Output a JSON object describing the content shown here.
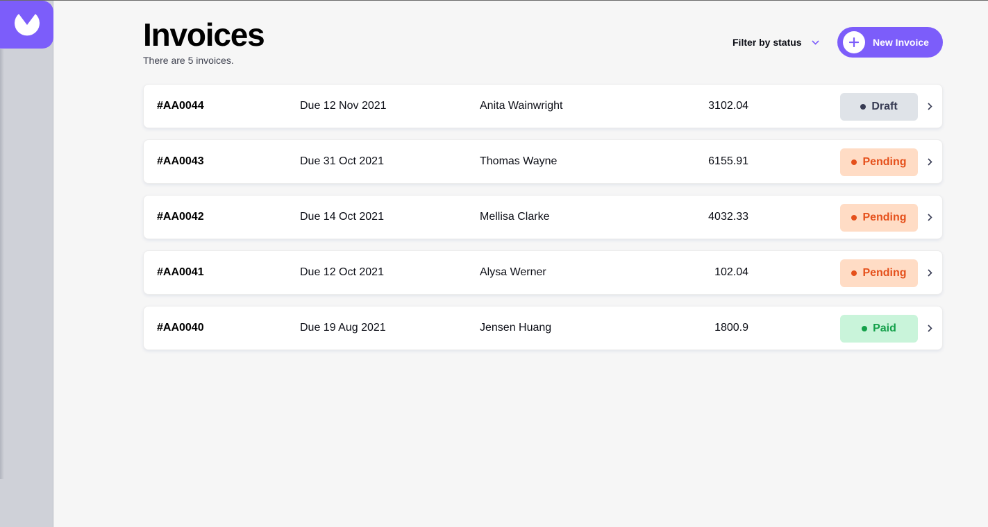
{
  "header": {
    "title": "Invoices",
    "subtitle": "There are 5 invoices.",
    "filter_label": "Filter by status",
    "new_invoice_label": "New Invoice"
  },
  "invoices": [
    {
      "id": "#AA0044",
      "due": "Due 12 Nov 2021",
      "client": "Anita Wainwright",
      "amount": "3102.04",
      "status": "Draft",
      "status_kind": "draft"
    },
    {
      "id": "#AA0043",
      "due": "Due 31 Oct 2021",
      "client": "Thomas Wayne",
      "amount": "6155.91",
      "status": "Pending",
      "status_kind": "pending"
    },
    {
      "id": "#AA0042",
      "due": "Due 14 Oct 2021",
      "client": "Mellisa Clarke",
      "amount": "4032.33",
      "status": "Pending",
      "status_kind": "pending"
    },
    {
      "id": "#AA0041",
      "due": "Due 12 Oct 2021",
      "client": "Alysa Werner",
      "amount": "102.04",
      "status": "Pending",
      "status_kind": "pending"
    },
    {
      "id": "#AA0040",
      "due": "Due 19 Aug 2021",
      "client": "Jensen Huang",
      "amount": "1800.9",
      "status": "Paid",
      "status_kind": "paid"
    }
  ],
  "colors": {
    "accent": "#7c5dfa",
    "draft": "#373b53",
    "pending": "#e5501b",
    "paid": "#14a04a"
  },
  "icons": {
    "logo": "app-logo-icon",
    "filter": "chevron-down-icon",
    "add": "plus-icon",
    "row": "chevron-right-icon"
  }
}
